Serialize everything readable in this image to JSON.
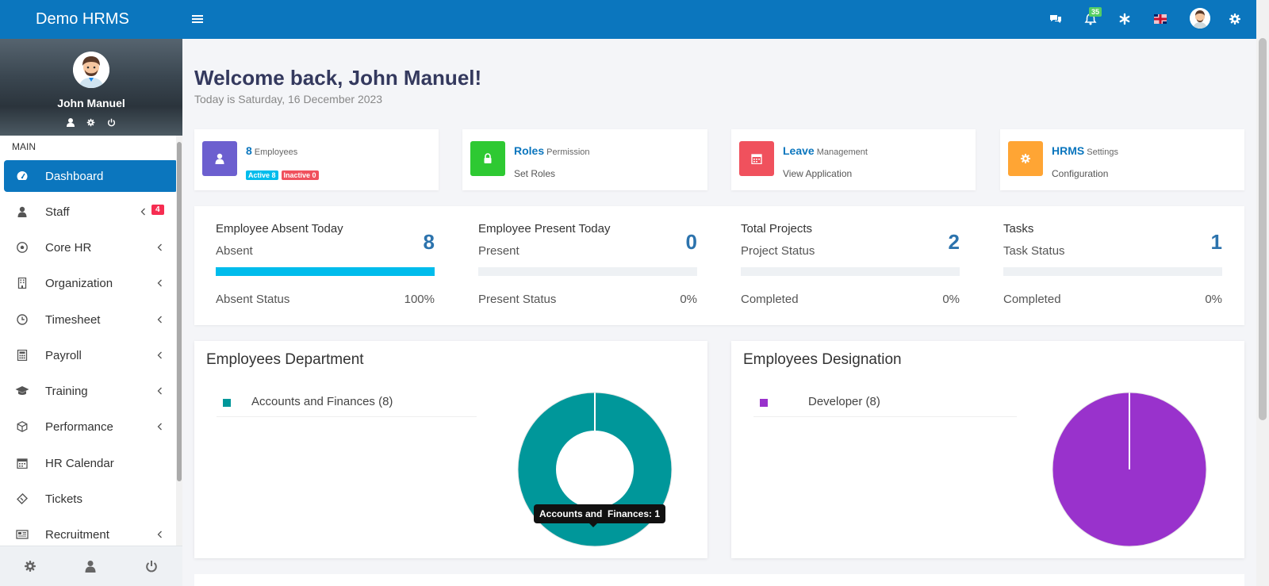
{
  "app": {
    "title": "Demo HRMS"
  },
  "topbar": {
    "notification_count": "35",
    "icons": [
      "menu-icon",
      "chat-icon",
      "bell-icon",
      "asterisk-icon",
      "flag-icon",
      "avatar",
      "gear-icon"
    ]
  },
  "sidebar": {
    "user": {
      "name": "John Manuel"
    },
    "section_label": "MAIN",
    "items": [
      {
        "label": "Dashboard",
        "icon": "dashboard-icon",
        "active": true
      },
      {
        "label": "Staff",
        "icon": "user-icon",
        "badge": "4"
      },
      {
        "label": "Core HR",
        "icon": "soccer-ball-icon"
      },
      {
        "label": "Organization",
        "icon": "building-icon"
      },
      {
        "label": "Timesheet",
        "icon": "clock-icon"
      },
      {
        "label": "Payroll",
        "icon": "calculator-icon"
      },
      {
        "label": "Training",
        "icon": "graduation-cap-icon"
      },
      {
        "label": "Performance",
        "icon": "cube-icon"
      },
      {
        "label": "HR Calendar",
        "icon": "calendar-icon"
      },
      {
        "label": "Tickets",
        "icon": "ticket-icon"
      },
      {
        "label": "Recruitment",
        "icon": "newspaper-icon"
      }
    ]
  },
  "welcome": {
    "heading": "Welcome back, John Manuel!",
    "date": "Today is Saturday, 16 December 2023"
  },
  "stat_cards": [
    {
      "bold": "8",
      "small": "Employees",
      "color": "#6c5fcf",
      "icon": "user-icon",
      "active": "Active 8",
      "inactive": "Inactive 0",
      "active_color": "#00bcec",
      "inactive_color": "#f0515d"
    },
    {
      "bold": "Roles",
      "small": "Permission",
      "sub": "Set Roles",
      "color": "#2ec932",
      "icon": "lock-icon"
    },
    {
      "bold": "Leave",
      "small": "Management",
      "sub": "View Application",
      "color": "#f0515d",
      "icon": "calendar-icon"
    },
    {
      "bold": "HRMS",
      "small": "Settings",
      "sub": "Configuration",
      "color": "#ffa534",
      "icon": "gear-icon"
    }
  ],
  "progress": [
    {
      "title": "Employee Absent Today",
      "sub": "Absent",
      "value": "8",
      "status": "Absent Status",
      "percent": "100%",
      "fill": 1.0
    },
    {
      "title": "Employee Present Today",
      "sub": "Present",
      "value": "0",
      "status": "Present Status",
      "percent": "0%",
      "fill": 0
    },
    {
      "title": "Total Projects",
      "sub": "Project Status",
      "value": "2",
      "status": "Completed",
      "percent": "0%",
      "fill": 0
    },
    {
      "title": "Tasks",
      "sub": "Task Status",
      "value": "1",
      "status": "Completed",
      "percent": "0%",
      "fill": 0
    }
  ],
  "chart_data": [
    {
      "type": "pie",
      "title": "Employees Department",
      "donut": true,
      "categories": [
        "Accounts and Finances (8)"
      ],
      "values": [
        8
      ],
      "colors": [
        "#00979a"
      ],
      "tooltip": "Accounts and  Finances: 1"
    },
    {
      "type": "pie",
      "title": "Employees Designation",
      "donut": false,
      "categories": [
        "Developer (8)"
      ],
      "values": [
        8
      ],
      "colors": [
        "#9932cc"
      ]
    }
  ]
}
